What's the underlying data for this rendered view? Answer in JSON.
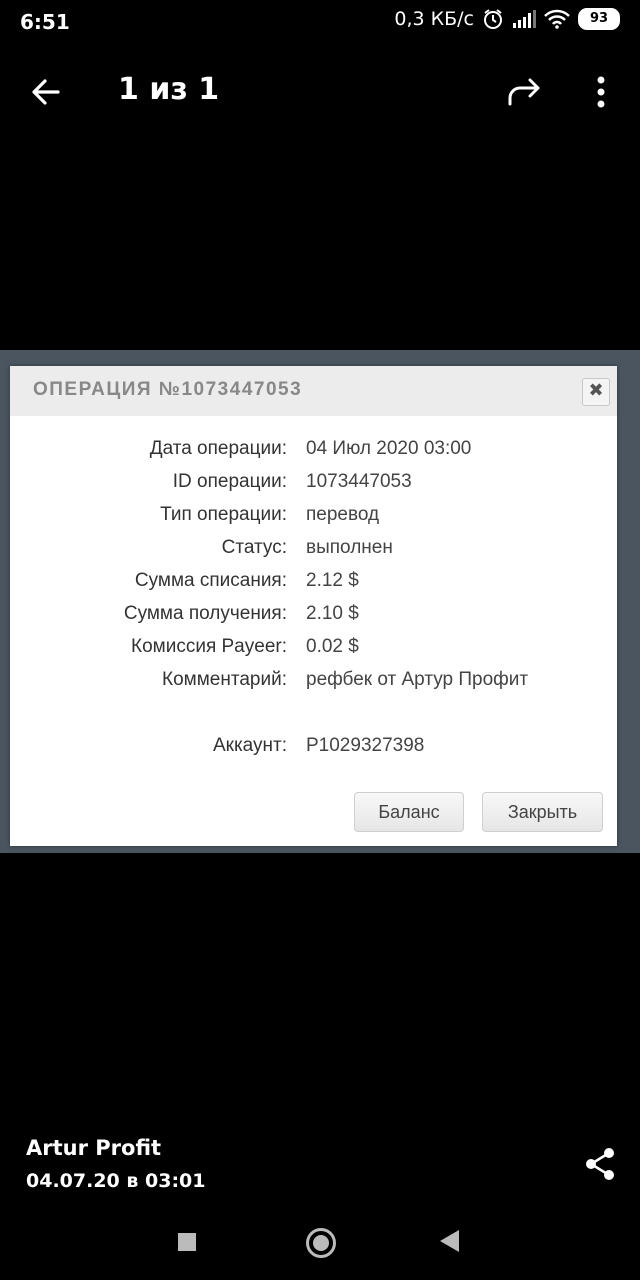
{
  "status_bar": {
    "time": "6:51",
    "speed": "0,3 КБ/с",
    "battery": "93",
    "icons": [
      "alarm-icon",
      "signal-icon",
      "wifi-icon",
      "battery-icon"
    ]
  },
  "header": {
    "title": "1 из 1",
    "icons": [
      "back-arrow-icon",
      "share-arrow-icon",
      "more-vert-icon"
    ]
  },
  "dialog": {
    "title": "ОПЕРАЦИЯ №1073447053",
    "close_glyph": "✖",
    "rows": [
      {
        "label": "Дата операции:",
        "value": "04 Июл 2020 03:00"
      },
      {
        "label": "ID операции:",
        "value": "1073447053"
      },
      {
        "label": "Тип операции:",
        "value": "перевод"
      },
      {
        "label": "Статус:",
        "value": "выполнен"
      },
      {
        "label": "Сумма списания:",
        "value": "2.12 $"
      },
      {
        "label": "Сумма получения:",
        "value": "2.10 $"
      },
      {
        "label": "Комиссия Payeer:",
        "value": "0.02 $"
      },
      {
        "label": "Комментарий:",
        "value": "рефбек от Артур Профит"
      },
      {
        "label": "Аккаунт:",
        "value": "P1029327398"
      }
    ],
    "buttons": {
      "balance": "Баланс",
      "close": "Закрыть"
    }
  },
  "footer": {
    "author": "Artur Profit",
    "date": "04.07.20 в 03:01"
  },
  "colors": {
    "background": "#000000",
    "dialog_bg": "#ffffff",
    "dialog_header": "#ececec"
  }
}
